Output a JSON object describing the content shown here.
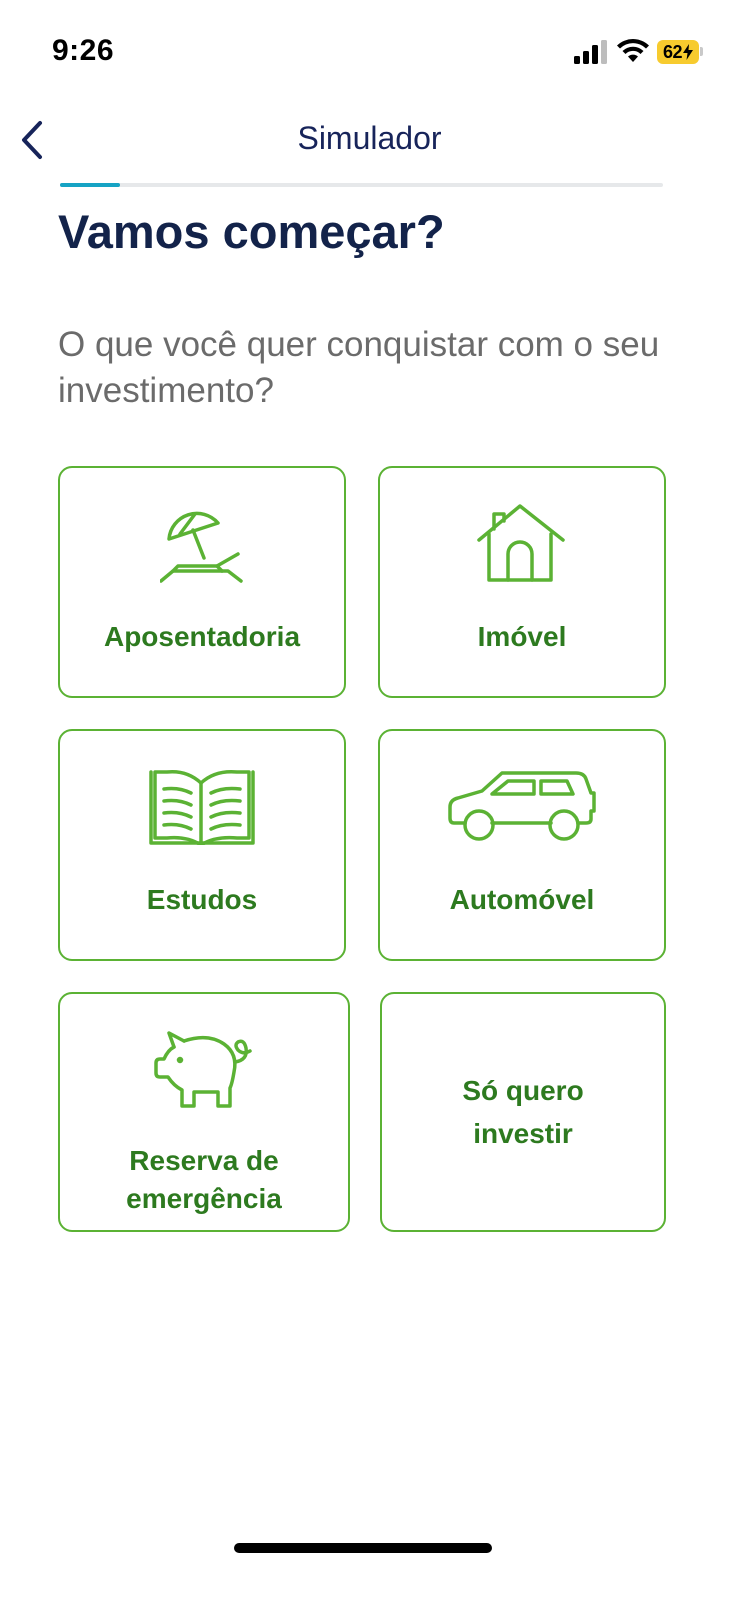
{
  "status_bar": {
    "time": "9:26",
    "battery": "62"
  },
  "header": {
    "title": "Simulador",
    "progress": 0.1
  },
  "main": {
    "heading": "Vamos começar?",
    "subtitle": "O que você quer conquistar com o seu investimento?",
    "options": [
      {
        "label": "Aposentadoria",
        "icon": "beach-umbrella-icon"
      },
      {
        "label": "Imóvel",
        "icon": "house-icon"
      },
      {
        "label": "Estudos",
        "icon": "book-icon"
      },
      {
        "label": "Automóvel",
        "icon": "car-icon"
      },
      {
        "label_line1": "Reserva de",
        "label_line2": "emergência",
        "icon": "piggy-bank-icon"
      },
      {
        "label_line1": "Só quero",
        "label_line2": "investir"
      }
    ]
  },
  "colors": {
    "accent_green": "#5bb234",
    "label_green": "#2d7a1f",
    "heading_navy": "#13234a",
    "progress_teal": "#16a3c4"
  }
}
